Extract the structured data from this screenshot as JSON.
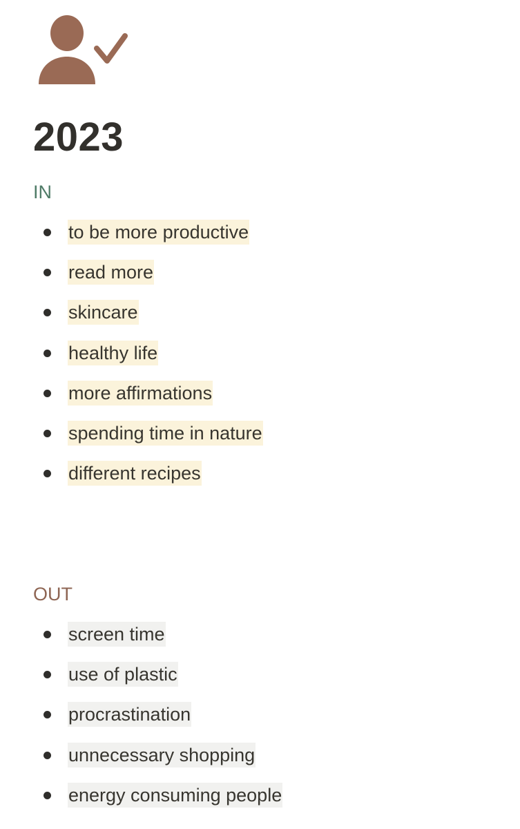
{
  "page": {
    "icon": "user-check-icon",
    "icon_color": "#9a6a55",
    "title": "2023"
  },
  "sections": {
    "in": {
      "heading": "IN",
      "heading_color": "#4f7b67",
      "highlight_color": "#fbf3db",
      "items": [
        {
          "label": "to be more productive"
        },
        {
          "label": "read more"
        },
        {
          "label": "skincare"
        },
        {
          "label": "healthy life"
        },
        {
          "label": "more affirmations"
        },
        {
          "label": "spending time in nature"
        },
        {
          "label": "different recipes"
        }
      ]
    },
    "out": {
      "heading": "OUT",
      "heading_color": "#8e6553",
      "highlight_color": "#f1f1ef",
      "items": [
        {
          "label": "screen time"
        },
        {
          "label": "use of plastic"
        },
        {
          "label": "procrastination"
        },
        {
          "label": "unnecessary shopping"
        },
        {
          "label": "energy consuming people"
        }
      ]
    }
  }
}
